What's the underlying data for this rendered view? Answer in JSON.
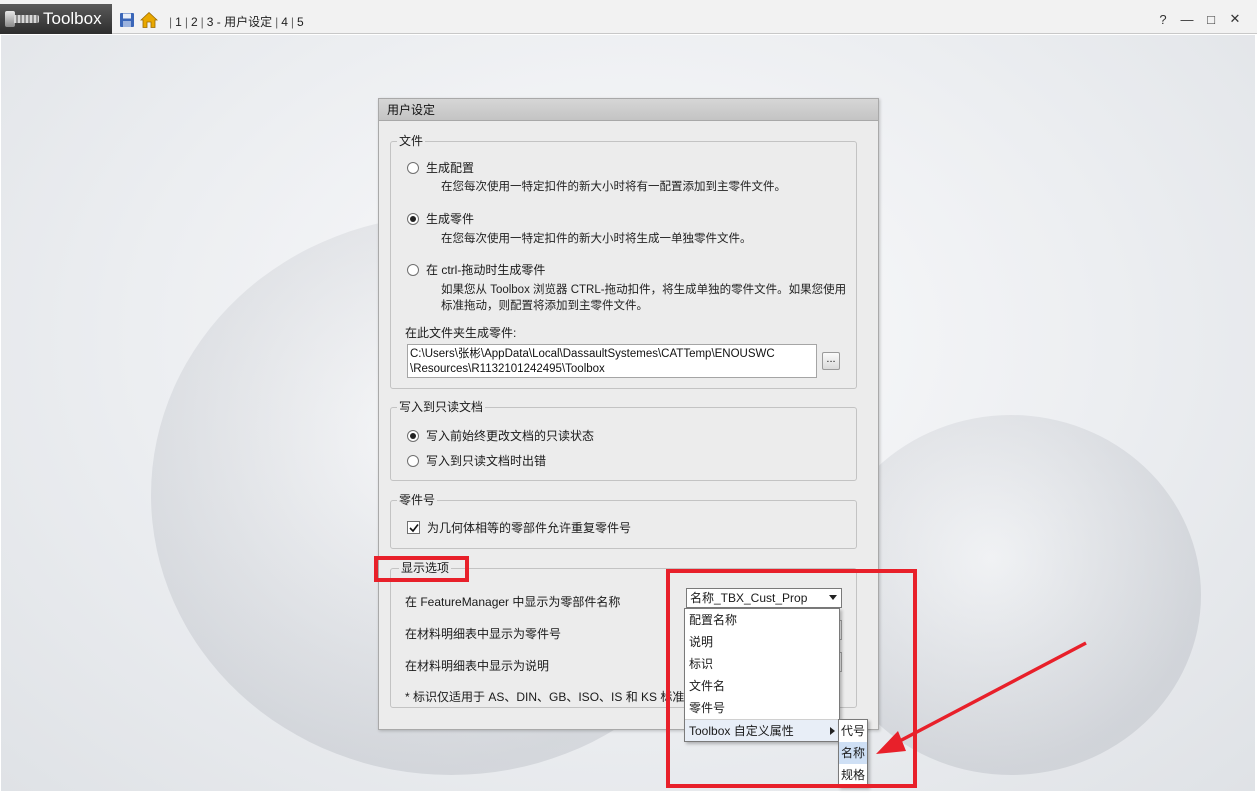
{
  "app": {
    "logo_text": "Toolbox",
    "breadcrumbs": [
      "1",
      "2",
      "3 - 用户设定",
      "4",
      "5"
    ]
  },
  "window_controls": {
    "help": "?",
    "minimize": "—",
    "restore": "□",
    "close": "✕"
  },
  "panel": {
    "title": "用户设定",
    "files_group": {
      "legend": "文件",
      "options": [
        {
          "label": "生成配置",
          "desc": "在您每次使用一特定扣件的新大小时将有一配置添加到主零件文件。",
          "selected": false
        },
        {
          "label": "生成零件",
          "desc": "在您每次使用一特定扣件的新大小时将生成一单独零件文件。",
          "selected": true
        },
        {
          "label": "在 ctrl-拖动时生成零件",
          "desc": "如果您从 Toolbox 浏览器 CTRL-拖动扣件，将生成单独的零件文件。如果您使用标准拖动，则配置将添加到主零件文件。",
          "selected": false
        }
      ],
      "folder_label": "在此文件夹生成零件:",
      "folder_path_line1": "C:\\Users\\张彬\\AppData\\Local\\DassaultSystemes\\CATTemp\\ENOUSWC",
      "folder_path_line2": "\\Resources\\R1132101242495\\Toolbox",
      "browse_label": "..."
    },
    "readonly_group": {
      "legend": "写入到只读文档",
      "options": [
        {
          "label": "写入前始终更改文档的只读状态",
          "selected": true
        },
        {
          "label": "写入到只读文档时出错",
          "selected": false
        }
      ]
    },
    "partnumber_group": {
      "legend": "零件号",
      "checkbox_label": "为几何体相等的零部件允许重复零件号",
      "checked": true
    },
    "display_group": {
      "legend": "显示选项",
      "rows": [
        {
          "label": "在 FeatureManager 中显示为零部件名称",
          "value": "名称_TBX_Cust_Prop"
        },
        {
          "label": "在材料明细表中显示为零件号"
        },
        {
          "label": "在材料明细表中显示为说明"
        }
      ],
      "footnote": "* 标识仅适用于 AS、DIN、GB、ISO、IS 和 KS 标准。"
    }
  },
  "dropdown": {
    "items": [
      "配置名称",
      "说明",
      "标识",
      "文件名",
      "零件号"
    ],
    "submenu_label": "Toolbox 自定义属性",
    "submenu_items": [
      "代号",
      "名称",
      "规格"
    ],
    "submenu_hover_index": 1
  },
  "colors": {
    "annotation_red": "#e8202a",
    "home_icon_yellow": "#e9a800",
    "save_icon_blue": "#3a66b8"
  }
}
